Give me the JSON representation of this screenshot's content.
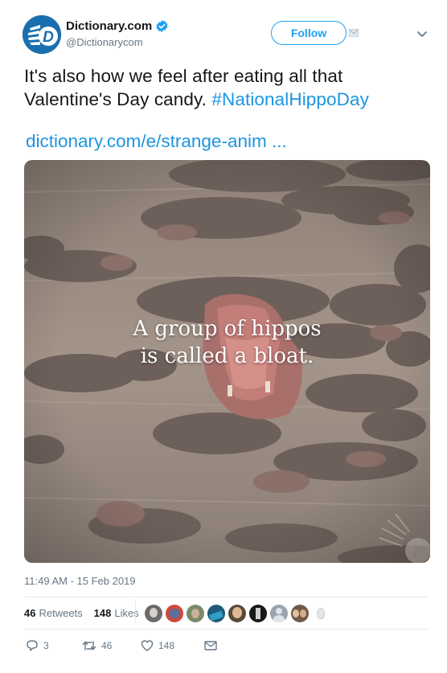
{
  "account": {
    "display_name": "Dictionary.com",
    "handle": "@Dictionarycom",
    "verified": true,
    "avatar_icon": "dictionary-logo-icon",
    "brand_color": "#1a6fb0"
  },
  "header": {
    "follow_label": "Follow",
    "menu_icon": "chevron-down-icon"
  },
  "tweet": {
    "text_line1": "It's also how we feel after eating all that",
    "text_line2_prefix": "Valentine's Day candy. ",
    "hashtag": "#NationalHippoDay",
    "link": "dictionary.com/e/strange-anim ...",
    "image_caption_line1": "A group of hippos",
    "image_caption_line2": "is called a bloat.",
    "timestamp": "11:49 AM - 15 Feb 2019"
  },
  "stats": {
    "retweets_count": "46",
    "retweets_label": "Retweets",
    "likes_count": "148",
    "likes_label": "Likes"
  },
  "actions": {
    "reply_count": "3",
    "retweet_count": "46",
    "like_count": "148"
  },
  "colors": {
    "link": "#1b95e0",
    "text": "#14171a",
    "muted": "#657786"
  }
}
